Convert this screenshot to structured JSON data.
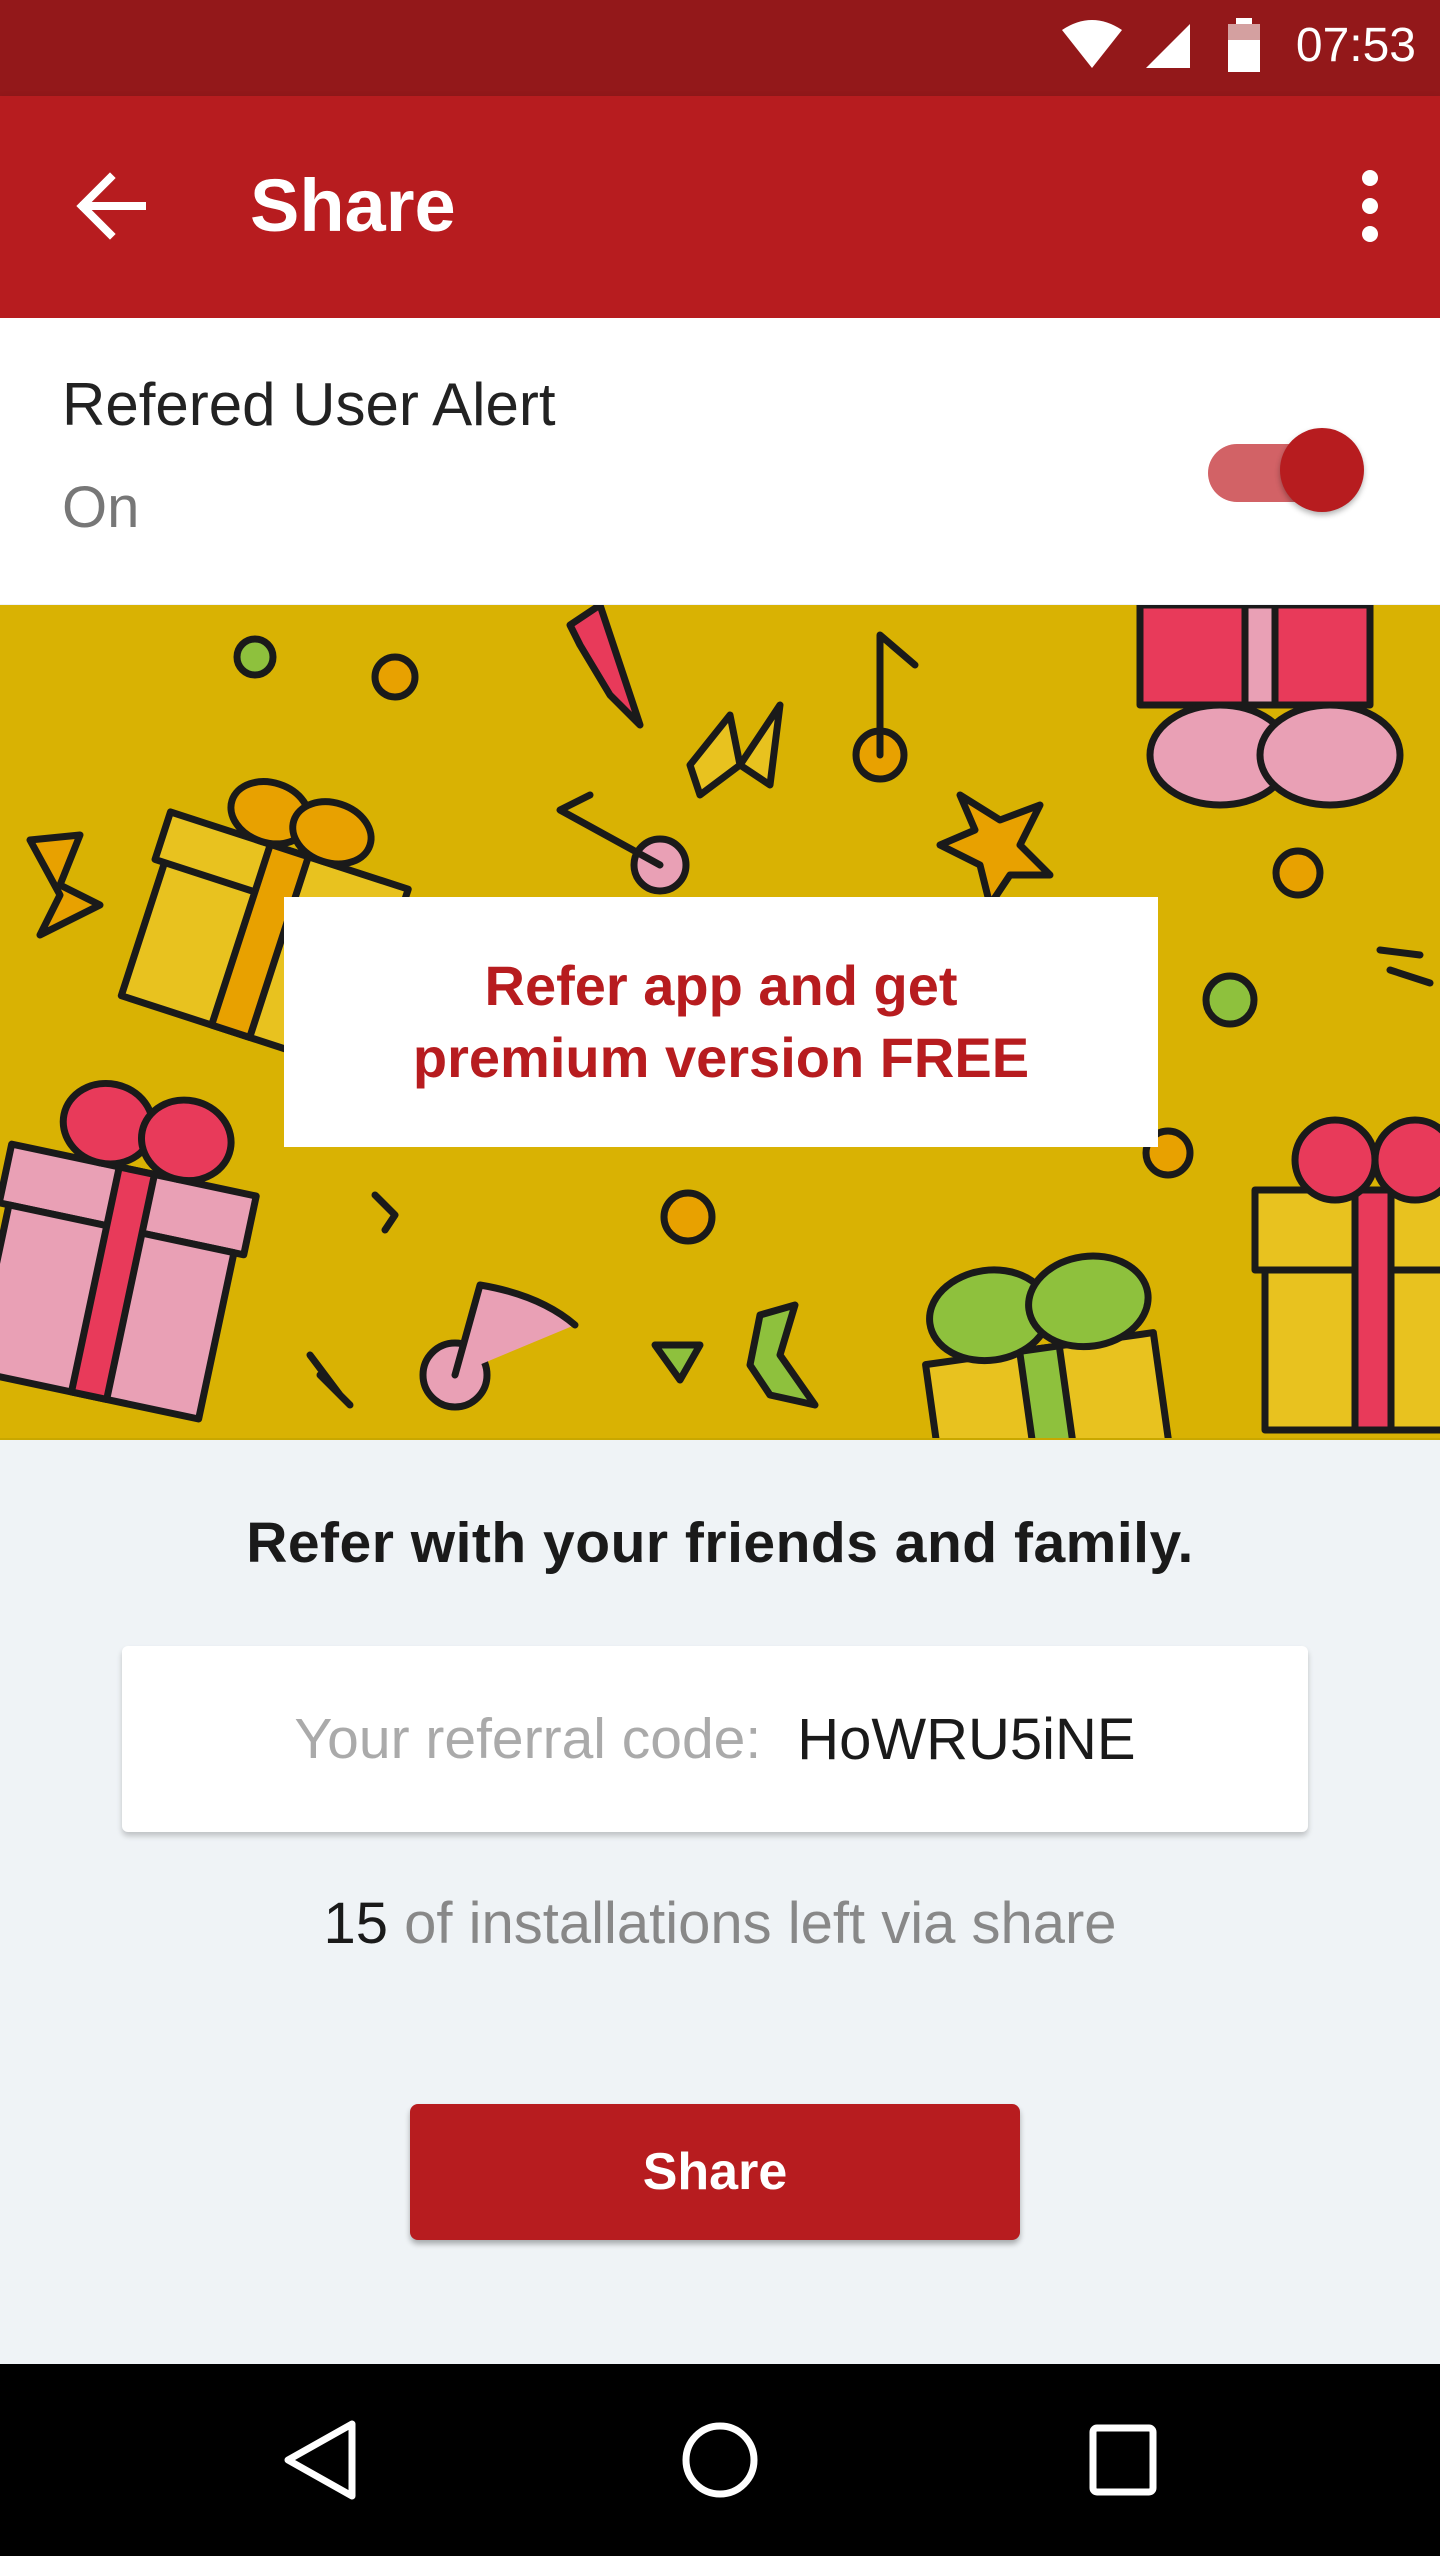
{
  "status_bar": {
    "time": "07:53",
    "icons": [
      "wifi-icon",
      "signal-icon",
      "battery-icon"
    ]
  },
  "app_bar": {
    "title": "Share",
    "back_icon": "arrow-back-icon",
    "menu_icon": "more-vert-icon",
    "color": "#b71c1f"
  },
  "alert_setting": {
    "label": "Refered User Alert",
    "state": "On",
    "enabled": true
  },
  "banner": {
    "promo_line1": "Refer app and get",
    "promo_line2": "premium version FREE",
    "background": "#d9b203"
  },
  "referral": {
    "heading": "Refer with your friends and family.",
    "code_label": "Your referral code:",
    "code": "HoWRU5iNE",
    "installs_count": "15",
    "installs_text": "of installations left via share",
    "share_button": "Share"
  },
  "nav_bar": {
    "icons": [
      "nav-back-icon",
      "nav-home-icon",
      "nav-recents-icon"
    ]
  }
}
